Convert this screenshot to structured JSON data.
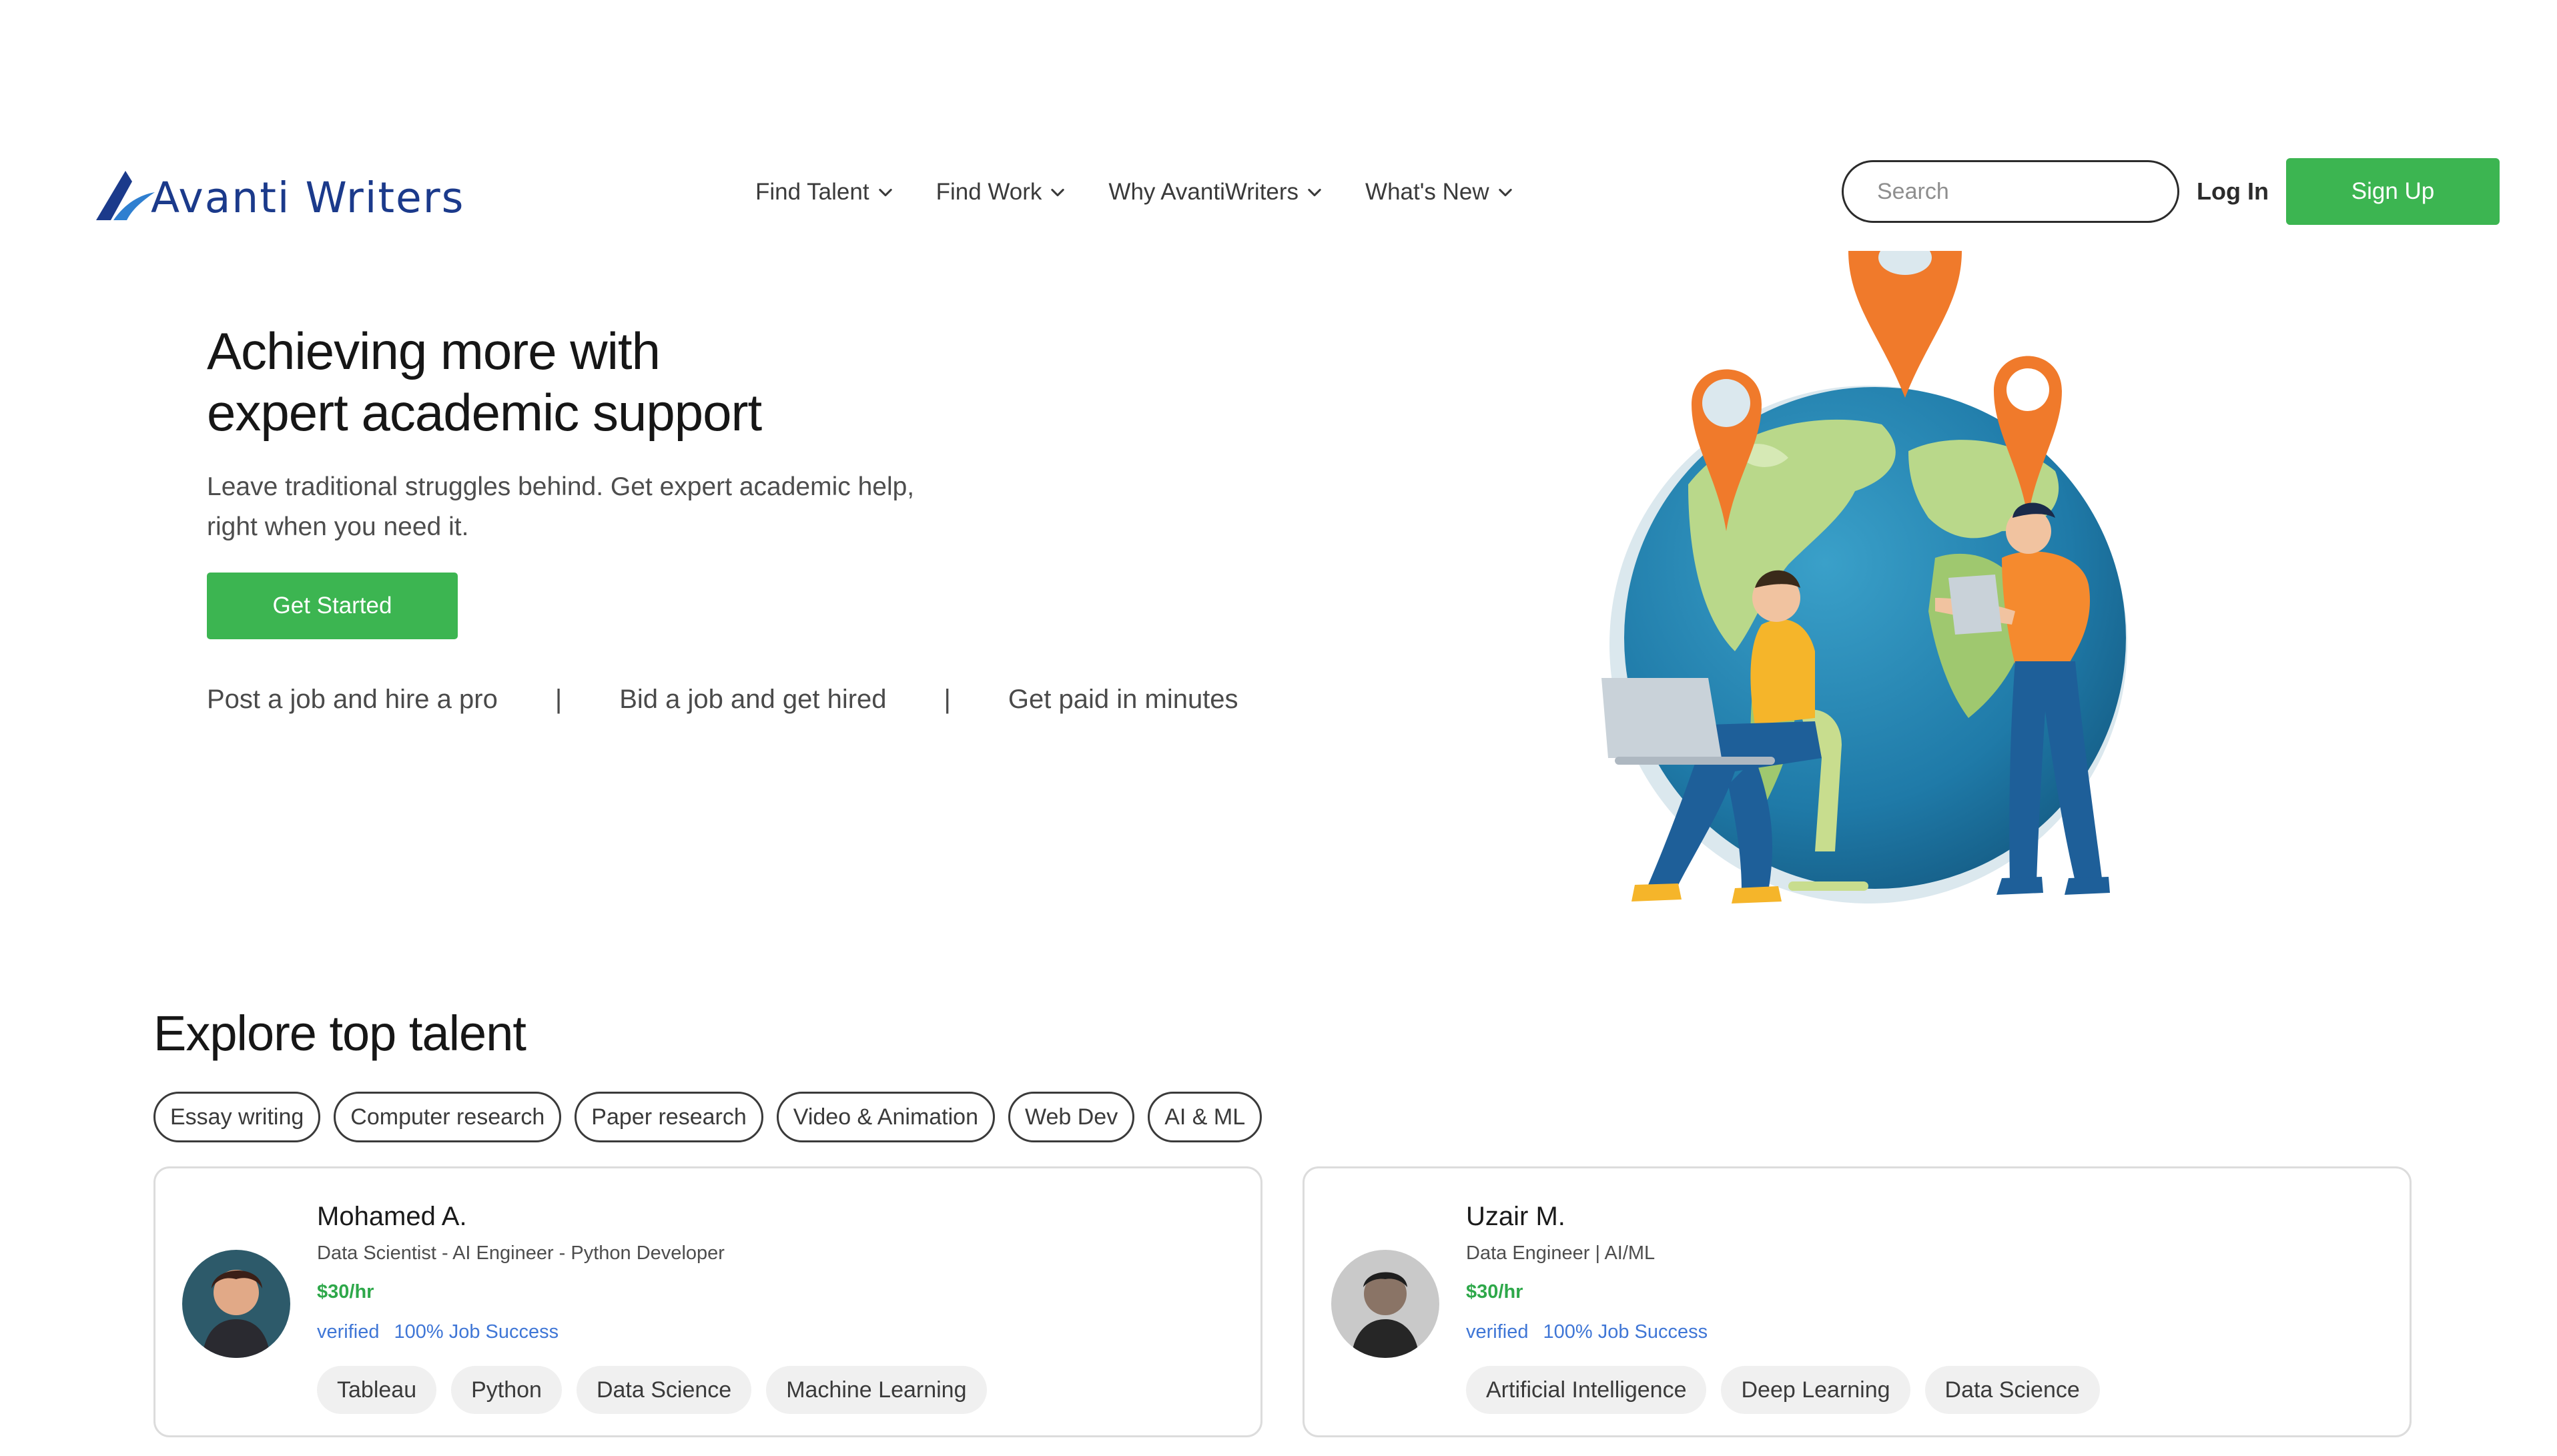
{
  "brand": {
    "name": "Avanti Writers",
    "color": "#1b3a8b"
  },
  "nav": {
    "items": [
      {
        "label": "Find Talent"
      },
      {
        "label": "Find Work"
      },
      {
        "label": "Why AvantiWriters"
      },
      {
        "label": "What's New"
      }
    ]
  },
  "search": {
    "placeholder": "Search",
    "value": ""
  },
  "auth": {
    "login_label": "Log In",
    "signup_label": "Sign Up"
  },
  "hero": {
    "title_line1": "Achieving more with",
    "title_line2": "expert academic support",
    "subtitle_line1": "Leave traditional struggles behind. Get expert academic help,",
    "subtitle_line2": "right when you need it.",
    "cta_label": "Get Started",
    "steps": [
      "Post a job and hire a pro",
      "Bid a job and get hired",
      "Get paid in minutes"
    ],
    "separator": "|"
  },
  "talent": {
    "title": "Explore top talent",
    "categories": [
      "Essay writing",
      "Computer research",
      "Paper research",
      "Video & Animation",
      "Web Dev",
      "AI & ML"
    ],
    "cards": [
      {
        "name": "Mohamed A.",
        "role": "Data Scientist - AI Engineer - Python Developer",
        "rate": "$30/hr",
        "verified": "verified",
        "success": "100% Job Success",
        "skills": [
          "Tableau",
          "Python",
          "Data Science",
          "Machine Learning"
        ]
      },
      {
        "name": "Uzair M.",
        "role": "Data Engineer | AI/ML",
        "rate": "$30/hr",
        "verified": "verified",
        "success": "100% Job Success",
        "skills": [
          "Artificial Intelligence",
          "Deep Learning",
          "Data Science"
        ]
      }
    ]
  },
  "colors": {
    "accent_green": "#3cb551",
    "link_blue": "#3f76d6",
    "rate_green": "#2ea84a"
  }
}
